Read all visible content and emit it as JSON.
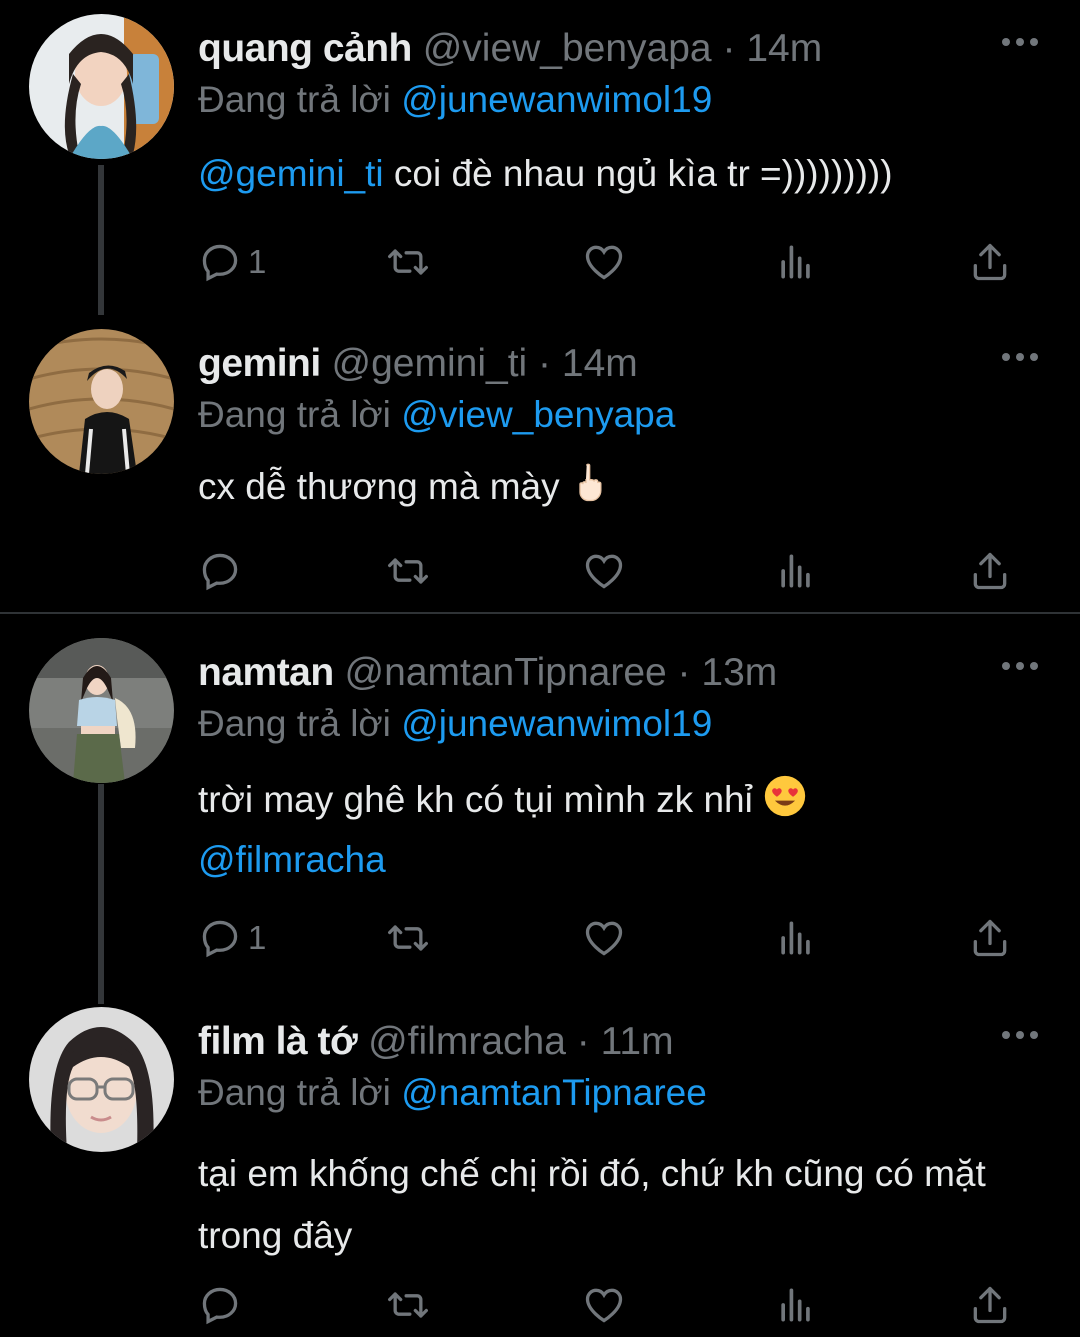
{
  "tweets": [
    {
      "name": "quang cảnh",
      "handle": "@view_benyapa",
      "separator": "·",
      "time": "14m",
      "reply_prefix": "Đang trả lời",
      "reply_to": "@junewanwimol19",
      "mention": "@gemini_ti",
      "text": " coi đè nhau ngủ kìa tr =)))))))))",
      "reply_count": "1",
      "avatar_icon": "avatar-quang-canh"
    },
    {
      "name": "gemini",
      "handle": "@gemini_ti",
      "separator": "·",
      "time": "14m",
      "reply_prefix": "Đang trả lời",
      "reply_to": "@view_benyapa",
      "text": "cx dễ thương mà mày ",
      "emoji": "middle-finger-emoji",
      "reply_count": "",
      "avatar_icon": "avatar-gemini"
    },
    {
      "name": "namtan",
      "handle": "@namtanTipnaree",
      "separator": "·",
      "time": "13m",
      "reply_prefix": "Đang trả lời",
      "reply_to": "@junewanwimol19",
      "text": "trời may ghê kh có tụi mình zk nhỉ ",
      "emoji": "heart-eyes-emoji",
      "mention_after": "@filmracha",
      "reply_count": "1",
      "avatar_icon": "avatar-namtan"
    },
    {
      "name": "film là tớ",
      "handle": "@filmracha",
      "separator": "·",
      "time": "11m",
      "reply_prefix": "Đang trả lời",
      "reply_to": "@namtanTipnaree",
      "text": "tại em khống chế chị rồi đó, chứ kh cũng có mặt trong đây",
      "reply_count": "",
      "avatar_icon": "avatar-film"
    }
  ],
  "colors": {
    "background": "#000000",
    "text": "#e7e9ea",
    "secondary": "#71767b",
    "link": "#1d9bf0",
    "divider": "#2f3336"
  },
  "icons": [
    "reply-icon",
    "retweet-icon",
    "like-icon",
    "views-icon",
    "share-icon",
    "more-icon"
  ]
}
